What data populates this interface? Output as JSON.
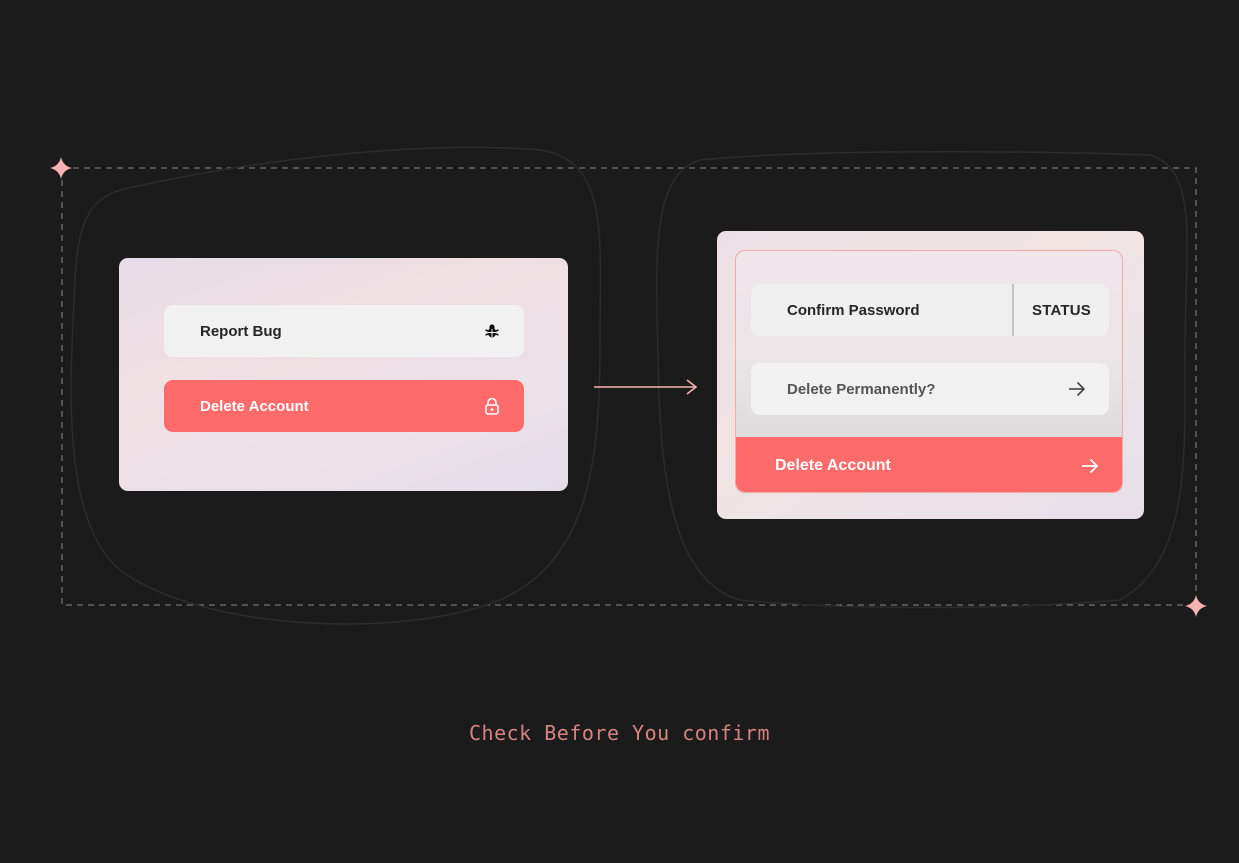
{
  "left_card": {
    "report_bug_label": "Report Bug",
    "report_bug_icon": "bug-icon",
    "delete_account_label": "Delete Account",
    "delete_account_icon": "lock-icon"
  },
  "right_card": {
    "confirm_password_label": "Confirm Password",
    "status_label": "STATUS",
    "delete_permanently_label": "Delete Permanently?",
    "delete_permanently_icon": "arrow-right-icon",
    "delete_account_label": "Delete Account",
    "delete_account_icon": "arrow-right-icon"
  },
  "transition_icon": "arrow-right-icon",
  "decoration_icon": "sparkle-icon",
  "caption": "Check Before You confirm",
  "colors": {
    "background": "#1b1b1b",
    "accent_red": "#ff6b6b",
    "pill_light": "#f1f1f1",
    "caption": "#d58380",
    "sparkle": "#f6b3b1"
  }
}
